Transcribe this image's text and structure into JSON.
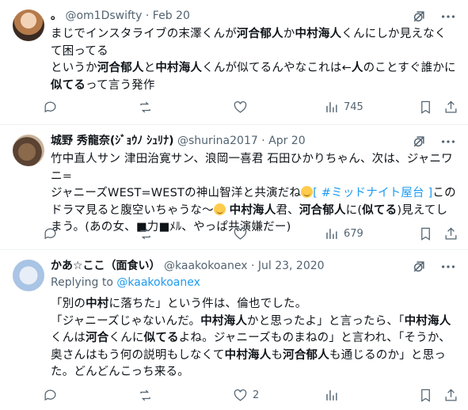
{
  "tweets": [
    {
      "name": "。",
      "handle": "@om1Dswifty",
      "sep": "·",
      "date": "Feb 20",
      "text_segments": [
        {
          "t": "まじでインスタライブの末澤くんが",
          "b": false
        },
        {
          "t": "河合郁人",
          "b": true
        },
        {
          "t": "か",
          "b": false
        },
        {
          "t": "中村海人",
          "b": true
        },
        {
          "t": "くんにしか見えなくて困ってる\nというか",
          "b": false
        },
        {
          "t": "河合郁人",
          "b": true
        },
        {
          "t": "と",
          "b": false
        },
        {
          "t": "中村海人",
          "b": true
        },
        {
          "t": "くんが似てるんやなこれは←",
          "b": false
        },
        {
          "t": "人",
          "b": true
        },
        {
          "t": "のことすぐ誰かに",
          "b": false
        },
        {
          "t": "似てる",
          "b": true
        },
        {
          "t": "って言う発作",
          "b": false
        }
      ],
      "views": "745"
    },
    {
      "name": "城野 秀龍奈(ｼﾞｮｳﾉ ｼｭﾘﾅ)",
      "handle": "@shurina2017",
      "sep": "·",
      "date": "Apr 20",
      "line1": "竹中直人サン 津田治寛サン、浪岡一喜君 石田ひかりちゃん、次は、ジャニワニ=",
      "line2_a": "ジャニーズWEST=WESTの神山智洋と共演だね",
      "hashtag": "[ #ミッドナイト屋台 ]",
      "line2_b": "この",
      "line3_a": "ドラマ見ると腹空いちゃうな〜",
      "line3_b1": "中村海人",
      "line3_b2": "君、",
      "line3_b3": "河合郁人",
      "line3_b4": "に(",
      "line3_b5": "似てる",
      "line3_b6": ")見えてし",
      "line4": "まう。(あの女、■力■ﾒﾙ、やっぱ共演嫌だー)",
      "views": "679"
    },
    {
      "name": "かあ☆ここ（面食い）",
      "handle": "@kaakokoanex",
      "sep": "·",
      "date": "Jul 23, 2020",
      "replying_label": "Replying to",
      "replying_handle": "@kaakokoanex",
      "p1_a": "「別の",
      "p1_b": "中村",
      "p1_c": "に落ちた」という件は、倫也でした。",
      "p2_a": "「ジャニーズじゃないんだ。",
      "p2_b": "中村海人",
      "p2_c": "かと思ったよ」と言ったら、「",
      "p2_d": "中村海人",
      "p3_a": "くんは",
      "p3_b": "河合",
      "p3_c": "くんに",
      "p3_d": "似てる",
      "p3_e": "よね。ジャニーズものまねの」と言われ、「そうか、",
      "p4_a": "奥さんはもう何の説明もしなくて",
      "p4_b": "中村海人",
      "p4_c": "も",
      "p4_d": "河合郁人",
      "p4_e": "も通じるのか」と思っ",
      "p5": "た。どんどんこっち来る。",
      "replies": "2"
    }
  ],
  "icons": {
    "reply": "speech-bubble-icon",
    "retweet": "retweet-icon",
    "like": "heart-icon",
    "views": "bar-chart-icon",
    "bookmark": "bookmark-icon",
    "share": "share-icon",
    "grok": "grok-icon",
    "more": "more-dots-icon"
  },
  "colors": {
    "link": "#1d9bf0",
    "muted": "#536471",
    "text": "#0f1419"
  }
}
